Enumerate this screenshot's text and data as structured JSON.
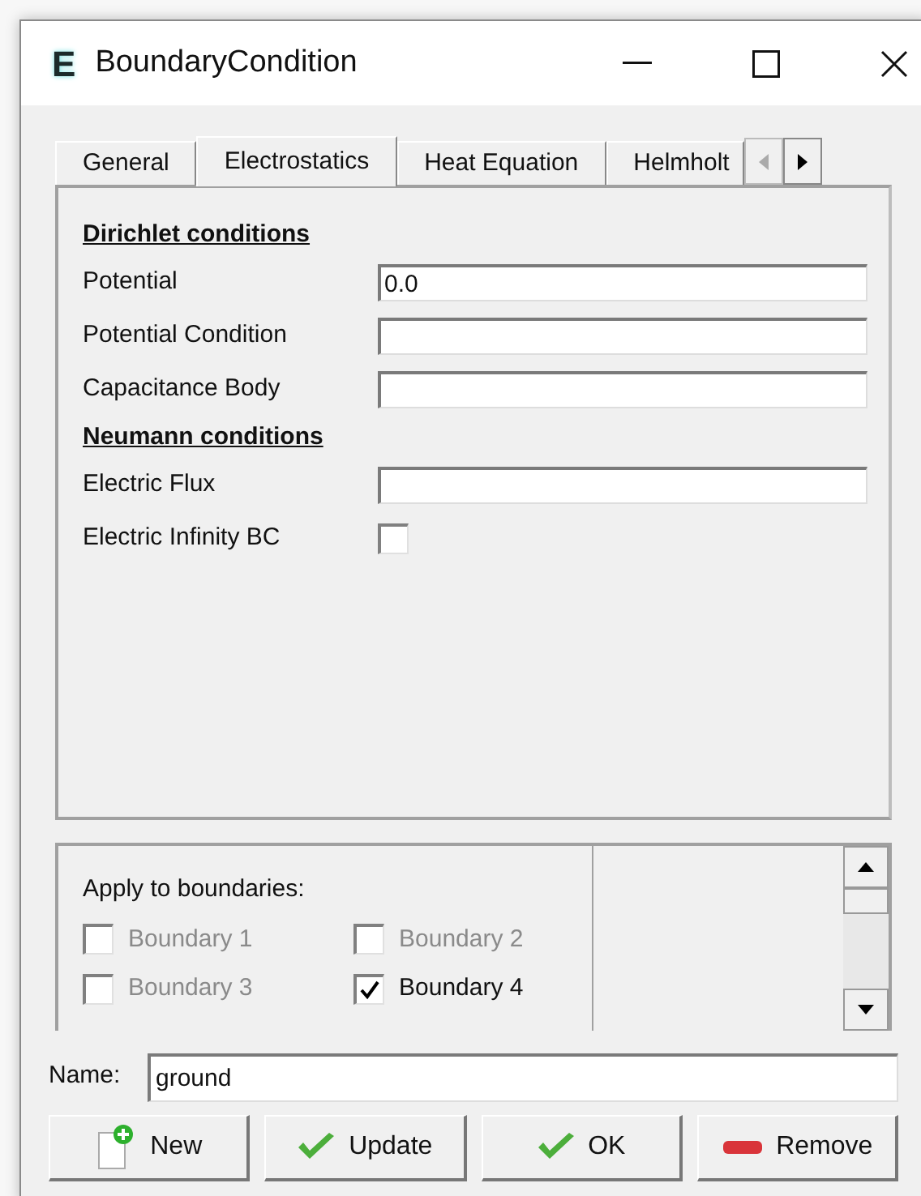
{
  "window": {
    "icon": "E",
    "title": "BoundaryCondition"
  },
  "tabs": [
    {
      "label": "General",
      "selected": false
    },
    {
      "label": "Electrostatics",
      "selected": true
    },
    {
      "label": "Heat Equation",
      "selected": false
    },
    {
      "label": "Helmholt",
      "selected": false
    }
  ],
  "sections": [
    {
      "heading": "Dirichlet conditions",
      "fields": [
        {
          "kind": "text",
          "label": "Potential",
          "value": "0.0"
        },
        {
          "kind": "text",
          "label": "Potential Condition"
        },
        {
          "kind": "text",
          "label": "Capacitance Body"
        }
      ]
    },
    {
      "heading": "Neumann conditions",
      "fields": [
        {
          "kind": "text",
          "label": "Electric Flux"
        },
        {
          "kind": "checkbox",
          "label": "Electric Infinity BC",
          "checked": false
        }
      ]
    }
  ],
  "boundaries": {
    "heading": "Apply to boundaries:",
    "items": [
      {
        "label": "Boundary 1",
        "checked": false
      },
      {
        "label": "Boundary 2",
        "checked": false
      },
      {
        "label": "Boundary 3",
        "checked": false
      },
      {
        "label": "Boundary 4",
        "checked": true
      }
    ]
  },
  "name": {
    "label": "Name:",
    "value": "ground"
  },
  "buttons": [
    {
      "kind": "new",
      "label": "New"
    },
    {
      "kind": "update",
      "label": "Update"
    },
    {
      "kind": "ok",
      "label": "OK"
    },
    {
      "kind": "remove",
      "label": "Remove"
    }
  ]
}
